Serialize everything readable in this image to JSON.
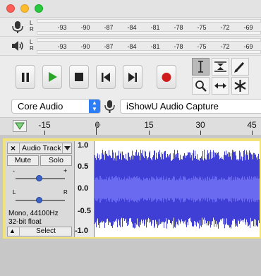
{
  "meters": {
    "record": {
      "l": "L",
      "r": "R",
      "ticks": [
        "-93",
        "-90",
        "-87",
        "-84",
        "-81",
        "-78",
        "-75",
        "-72",
        "-69"
      ]
    },
    "playback": {
      "l": "L",
      "r": "R",
      "ticks": [
        "-93",
        "-90",
        "-87",
        "-84",
        "-81",
        "-78",
        "-75",
        "-72",
        "-69"
      ]
    }
  },
  "devices": {
    "host": "Core Audio",
    "input": "iShowU Audio Capture"
  },
  "timeline": {
    "labels": [
      "-15",
      "0",
      "15",
      "30",
      "45"
    ]
  },
  "track": {
    "name": "Audio Track",
    "mute_label": "Mute",
    "solo_label": "Solo",
    "gain_minus": "-",
    "gain_plus": "+",
    "pan_left": "L",
    "pan_right": "R",
    "info_line1": "Mono, 44100Hz",
    "info_line2": "32-bit float",
    "select_label": "Select",
    "close_glyph": "×",
    "collapse_glyph": "▲",
    "ruler": [
      "1.0",
      "0.5",
      "0.0",
      "-0.5",
      "-1.0"
    ]
  },
  "colors": {
    "waveform": "#3f3fd6",
    "rms": "#6a6af0",
    "selection_border": "#f2e27a",
    "record": "#cf1d1d",
    "play": "#2aa52a"
  }
}
